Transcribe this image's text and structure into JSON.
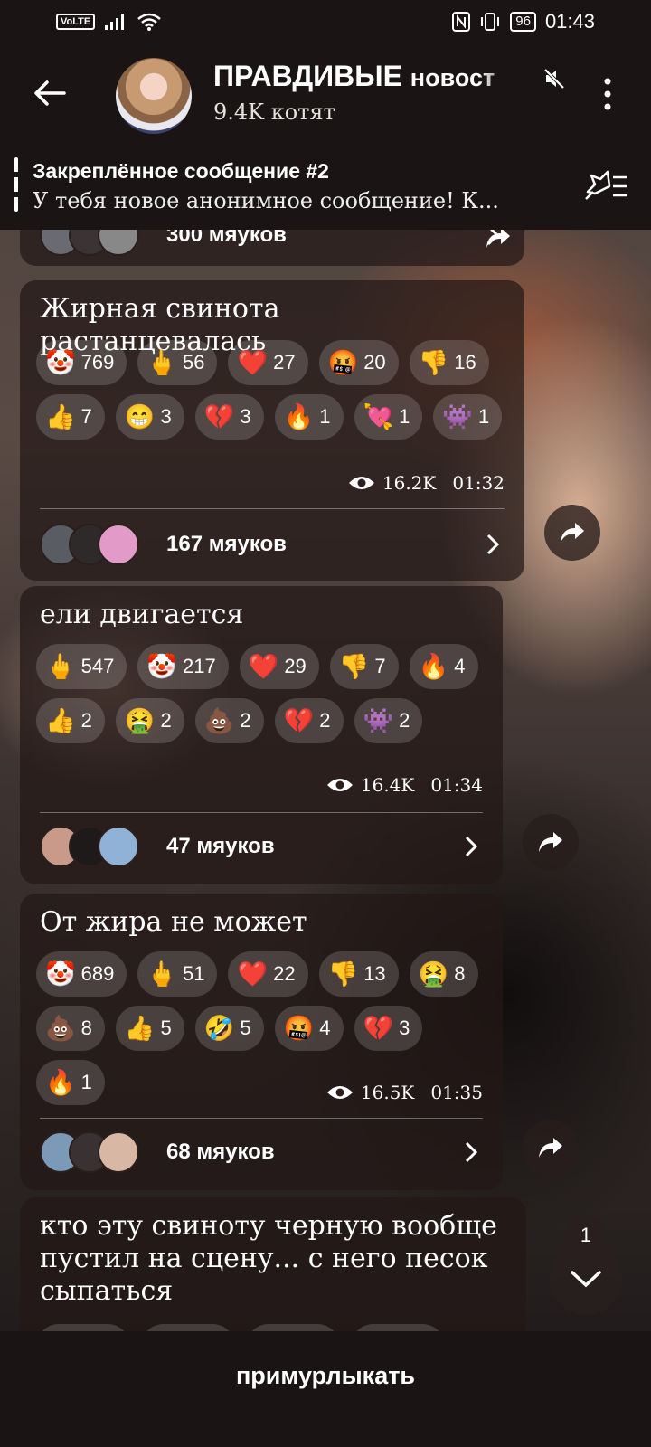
{
  "status_bar": {
    "network_chip": "VoLTE",
    "battery": "96",
    "time": "01:43"
  },
  "header": {
    "title": "ПРАВДИВЫЕ",
    "title_rest": "новост",
    "subscribers": "9.4K котят"
  },
  "pinned": {
    "title": "Закреплённое сообщение #2",
    "text": "У тебя новое анонимное сообщение!  К..."
  },
  "messages": [
    {
      "text": "",
      "reactions": [],
      "views": "",
      "time": "",
      "comments": "300 мяуков"
    },
    {
      "text": "Жирная свинота растанцевалась",
      "reactions": [
        {
          "emoji": "🤡",
          "count": "769"
        },
        {
          "emoji": "🖕",
          "count": "56"
        },
        {
          "emoji": "❤️",
          "count": "27"
        },
        {
          "emoji": "🤬",
          "count": "20"
        },
        {
          "emoji": "👎",
          "count": "16"
        },
        {
          "emoji": "👍",
          "count": "7"
        },
        {
          "emoji": "😁",
          "count": "3"
        },
        {
          "emoji": "💔",
          "count": "3"
        },
        {
          "emoji": "🔥",
          "count": "1"
        },
        {
          "emoji": "💘",
          "count": "1"
        },
        {
          "emoji": "👾",
          "count": "1"
        }
      ],
      "views": "16.2K",
      "time": "01:32",
      "comments": "167 мяуков"
    },
    {
      "text": "ели двигается",
      "reactions": [
        {
          "emoji": "🖕",
          "count": "547"
        },
        {
          "emoji": "🤡",
          "count": "217"
        },
        {
          "emoji": "❤️",
          "count": "29"
        },
        {
          "emoji": "👎",
          "count": "7"
        },
        {
          "emoji": "🔥",
          "count": "4"
        },
        {
          "emoji": "👍",
          "count": "2"
        },
        {
          "emoji": "🤮",
          "count": "2"
        },
        {
          "emoji": "💩",
          "count": "2"
        },
        {
          "emoji": "💔",
          "count": "2"
        },
        {
          "emoji": "👾",
          "count": "2"
        }
      ],
      "views": "16.4K",
      "time": "01:34",
      "comments": "47 мяуков"
    },
    {
      "text": "От жира не может",
      "reactions": [
        {
          "emoji": "🤡",
          "count": "689"
        },
        {
          "emoji": "🖕",
          "count": "51"
        },
        {
          "emoji": "❤️",
          "count": "22"
        },
        {
          "emoji": "👎",
          "count": "13"
        },
        {
          "emoji": "🤮",
          "count": "8"
        },
        {
          "emoji": "💩",
          "count": "8"
        },
        {
          "emoji": "👍",
          "count": "5"
        },
        {
          "emoji": "🤣",
          "count": "5"
        },
        {
          "emoji": "🤬",
          "count": "4"
        },
        {
          "emoji": "💔",
          "count": "3"
        },
        {
          "emoji": "🔥",
          "count": "1"
        }
      ],
      "views": "16.5K",
      "time": "01:35",
      "comments": "68 мяуков"
    },
    {
      "text": "кто эту свиноту черную вообще пустил на сцену... с него песок сыпаться",
      "reactions": [],
      "views": "",
      "time": "",
      "comments": ""
    }
  ],
  "scroll": {
    "unread": "1"
  },
  "bottom": {
    "action": "примурлыкать"
  },
  "colors": {
    "bar_bg": "#1a1414",
    "bubble_bg": "rgba(34,24,22,0.72)",
    "pill_bg": "rgba(255,255,255,0.16)"
  }
}
